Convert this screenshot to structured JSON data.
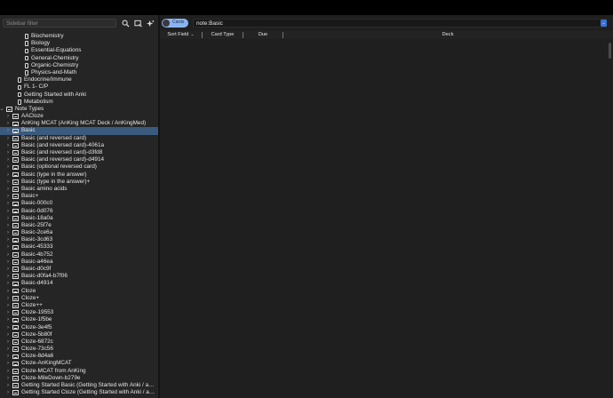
{
  "sidebar": {
    "filter_placeholder": "Sidebar filter",
    "icons": [
      "search-icon",
      "select-icon",
      "sparkle-icon"
    ],
    "items": [
      {
        "label": "Biochemistry",
        "type": "deck",
        "depth": 3,
        "chevron": ""
      },
      {
        "label": "Biology",
        "type": "deck",
        "depth": 3,
        "chevron": ""
      },
      {
        "label": "Essential-Equations",
        "type": "deck",
        "depth": 3,
        "chevron": ""
      },
      {
        "label": "General-Chemistry",
        "type": "deck",
        "depth": 3,
        "chevron": ""
      },
      {
        "label": "Organic-Chemistry",
        "type": "deck",
        "depth": 3,
        "chevron": ""
      },
      {
        "label": "Physics-and-Math",
        "type": "deck",
        "depth": 3,
        "chevron": ""
      },
      {
        "label": "Endocrine/Immune",
        "type": "deck",
        "depth": 2,
        "chevron": ""
      },
      {
        "label": "FL 1- C/P",
        "type": "deck",
        "depth": 2,
        "chevron": ""
      },
      {
        "label": "Getting Started with Anki",
        "type": "deck",
        "depth": 2,
        "chevron": ""
      },
      {
        "label": "Metabolism",
        "type": "deck",
        "depth": 2,
        "chevron": ""
      },
      {
        "label": "Note Types",
        "type": "nt",
        "depth": 0,
        "chevron": "⌄"
      },
      {
        "label": "AACloze",
        "type": "nt",
        "depth": 1,
        "chevron": "›"
      },
      {
        "label": "AnKing MCAT (AnKing MCAT Deck / AnKingMed)",
        "type": "nt",
        "depth": 1,
        "chevron": "›"
      },
      {
        "label": "Basic",
        "type": "nt",
        "depth": 1,
        "chevron": "›",
        "selected": true
      },
      {
        "label": "Basic (and reversed card)",
        "type": "nt",
        "depth": 1,
        "chevron": "›"
      },
      {
        "label": "Basic (and reversed card)-4061a",
        "type": "nt",
        "depth": 1,
        "chevron": "›"
      },
      {
        "label": "Basic (and reversed card)-d3fd8",
        "type": "nt",
        "depth": 1,
        "chevron": "›"
      },
      {
        "label": "Basic (and reversed card)-d4914",
        "type": "nt",
        "depth": 1,
        "chevron": "›"
      },
      {
        "label": "Basic (optional reversed card)",
        "type": "nt",
        "depth": 1,
        "chevron": "›"
      },
      {
        "label": "Basic (type in the answer)",
        "type": "nt",
        "depth": 1,
        "chevron": "›"
      },
      {
        "label": "Basic (type in the answer)+",
        "type": "nt",
        "depth": 1,
        "chevron": "›"
      },
      {
        "label": "Basic amino acids",
        "type": "nt",
        "depth": 1,
        "chevron": "›"
      },
      {
        "label": "Basic+",
        "type": "nt",
        "depth": 1,
        "chevron": "›"
      },
      {
        "label": "Basic-000c0",
        "type": "nt",
        "depth": 1,
        "chevron": "›"
      },
      {
        "label": "Basic-0d076",
        "type": "nt",
        "depth": 1,
        "chevron": "›"
      },
      {
        "label": "Basic-18a0a",
        "type": "nt",
        "depth": 1,
        "chevron": "›"
      },
      {
        "label": "Basic-25f7e",
        "type": "nt",
        "depth": 1,
        "chevron": "›"
      },
      {
        "label": "Basic-2ce6a",
        "type": "nt",
        "depth": 1,
        "chevron": "›"
      },
      {
        "label": "Basic-3cd63",
        "type": "nt",
        "depth": 1,
        "chevron": "›"
      },
      {
        "label": "Basic-45333",
        "type": "nt",
        "depth": 1,
        "chevron": "›"
      },
      {
        "label": "Basic-4b752",
        "type": "nt",
        "depth": 1,
        "chevron": "›"
      },
      {
        "label": "Basic-a46ea",
        "type": "nt",
        "depth": 1,
        "chevron": "›"
      },
      {
        "label": "Basic-d0c9f",
        "type": "nt",
        "depth": 1,
        "chevron": "›"
      },
      {
        "label": "Basic-d0fa4-b7f06",
        "type": "nt",
        "depth": 1,
        "chevron": "›"
      },
      {
        "label": "Basic-d4914",
        "type": "nt",
        "depth": 1,
        "chevron": "›"
      },
      {
        "label": "Cloze",
        "type": "nt",
        "depth": 1,
        "chevron": "›"
      },
      {
        "label": "Cloze+",
        "type": "nt",
        "depth": 1,
        "chevron": "›"
      },
      {
        "label": "Cloze++",
        "type": "nt",
        "depth": 1,
        "chevron": "›"
      },
      {
        "label": "Cloze-19553",
        "type": "nt",
        "depth": 1,
        "chevron": "›"
      },
      {
        "label": "Cloze-1f5be",
        "type": "nt",
        "depth": 1,
        "chevron": "›"
      },
      {
        "label": "Cloze-3e4f5",
        "type": "nt",
        "depth": 1,
        "chevron": "›"
      },
      {
        "label": "Cloze-5b80f",
        "type": "nt",
        "depth": 1,
        "chevron": "›"
      },
      {
        "label": "Cloze-6872c",
        "type": "nt",
        "depth": 1,
        "chevron": "›"
      },
      {
        "label": "Cloze-73c56",
        "type": "nt",
        "depth": 1,
        "chevron": "›"
      },
      {
        "label": "Cloze-8d4a6",
        "type": "nt",
        "depth": 1,
        "chevron": "›"
      },
      {
        "label": "Cloze-AnKingMCAT",
        "type": "nt",
        "depth": 1,
        "chevron": "›"
      },
      {
        "label": "Cloze-MCAT from AnKing",
        "type": "nt",
        "depth": 1,
        "chevron": "›"
      },
      {
        "label": "Cloze-MileDown-b279e",
        "type": "nt",
        "depth": 1,
        "chevron": "›"
      },
      {
        "label": "Getting Started Basic (Getting Started with Anki / a…",
        "type": "nt",
        "depth": 1,
        "chevron": "›"
      },
      {
        "label": "Getting Started Cloze (Getting Started with Anki / a…",
        "type": "nt",
        "depth": 1,
        "chevron": "›"
      }
    ]
  },
  "toolbar": {
    "toggle_label": "Cards",
    "search_value": "note:Basic",
    "dropdown_icon": "chevron-down-icon"
  },
  "table": {
    "columns": [
      "Sort Field",
      "Card Type",
      "Due",
      "Deck"
    ],
    "sort_column": "Sort Field"
  },
  "colors": {
    "accent": "#3a73d6",
    "toggle": "#8ab4f0",
    "selection": "#3a5a7e"
  }
}
